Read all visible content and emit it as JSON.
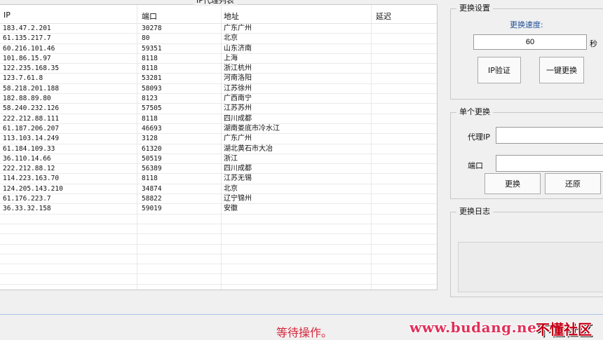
{
  "proxy_list": {
    "title": "IP代理列表",
    "columns": [
      "IP",
      "端口",
      "地址",
      "延迟"
    ],
    "rows": [
      {
        "ip": "183.47.2.201",
        "port": "30278",
        "addr": "广东广州"
      },
      {
        "ip": "61.135.217.7",
        "port": "80",
        "addr": "北京"
      },
      {
        "ip": "60.216.101.46",
        "port": "59351",
        "addr": "山东济南"
      },
      {
        "ip": "101.86.15.97",
        "port": "8118",
        "addr": "上海"
      },
      {
        "ip": "122.235.168.35",
        "port": "8118",
        "addr": "浙江杭州"
      },
      {
        "ip": "123.7.61.8",
        "port": "53281",
        "addr": "河南洛阳"
      },
      {
        "ip": "58.218.201.188",
        "port": "58093",
        "addr": "江苏徐州"
      },
      {
        "ip": "182.88.89.80",
        "port": "8123",
        "addr": "广西南宁"
      },
      {
        "ip": "58.240.232.126",
        "port": "57505",
        "addr": "江苏苏州"
      },
      {
        "ip": "222.212.88.111",
        "port": "8118",
        "addr": "四川成都"
      },
      {
        "ip": "61.187.206.207",
        "port": "46693",
        "addr": "湖南娄底市冷水江"
      },
      {
        "ip": "113.103.14.249",
        "port": "3128",
        "addr": "广东广州"
      },
      {
        "ip": "61.184.109.33",
        "port": "61320",
        "addr": "湖北黄石市大冶"
      },
      {
        "ip": "36.110.14.66",
        "port": "50519",
        "addr": "浙江"
      },
      {
        "ip": "222.212.88.12",
        "port": "56389",
        "addr": "四川成都"
      },
      {
        "ip": "114.223.163.70",
        "port": "8118",
        "addr": "江苏无锡"
      },
      {
        "ip": "124.205.143.210",
        "port": "34874",
        "addr": "北京"
      },
      {
        "ip": "61.176.223.7",
        "port": "58822",
        "addr": "辽宁锦州"
      },
      {
        "ip": "36.33.32.158",
        "port": "59019",
        "addr": "安徽"
      }
    ]
  },
  "switch_settings": {
    "title": "更换设置",
    "speed_label": "更换速度:",
    "speed_value": "60",
    "speed_unit": "秒",
    "verify_button": "IP验证",
    "oneclick_button": "一键更换"
  },
  "single_switch": {
    "title": "单个更换",
    "proxy_ip_label": "代理IP",
    "proxy_ip_value": "",
    "port_label": "端口",
    "port_value": "",
    "switch_button": "更换",
    "restore_button": "还原"
  },
  "log": {
    "title": "更换日志"
  },
  "status": {
    "text": "等待操作。"
  },
  "watermark": {
    "site": "www.budang.net",
    "brand": "不懂社区"
  },
  "colors": {
    "status_text": "#d6253b",
    "speed_label": "#1f4f96"
  }
}
